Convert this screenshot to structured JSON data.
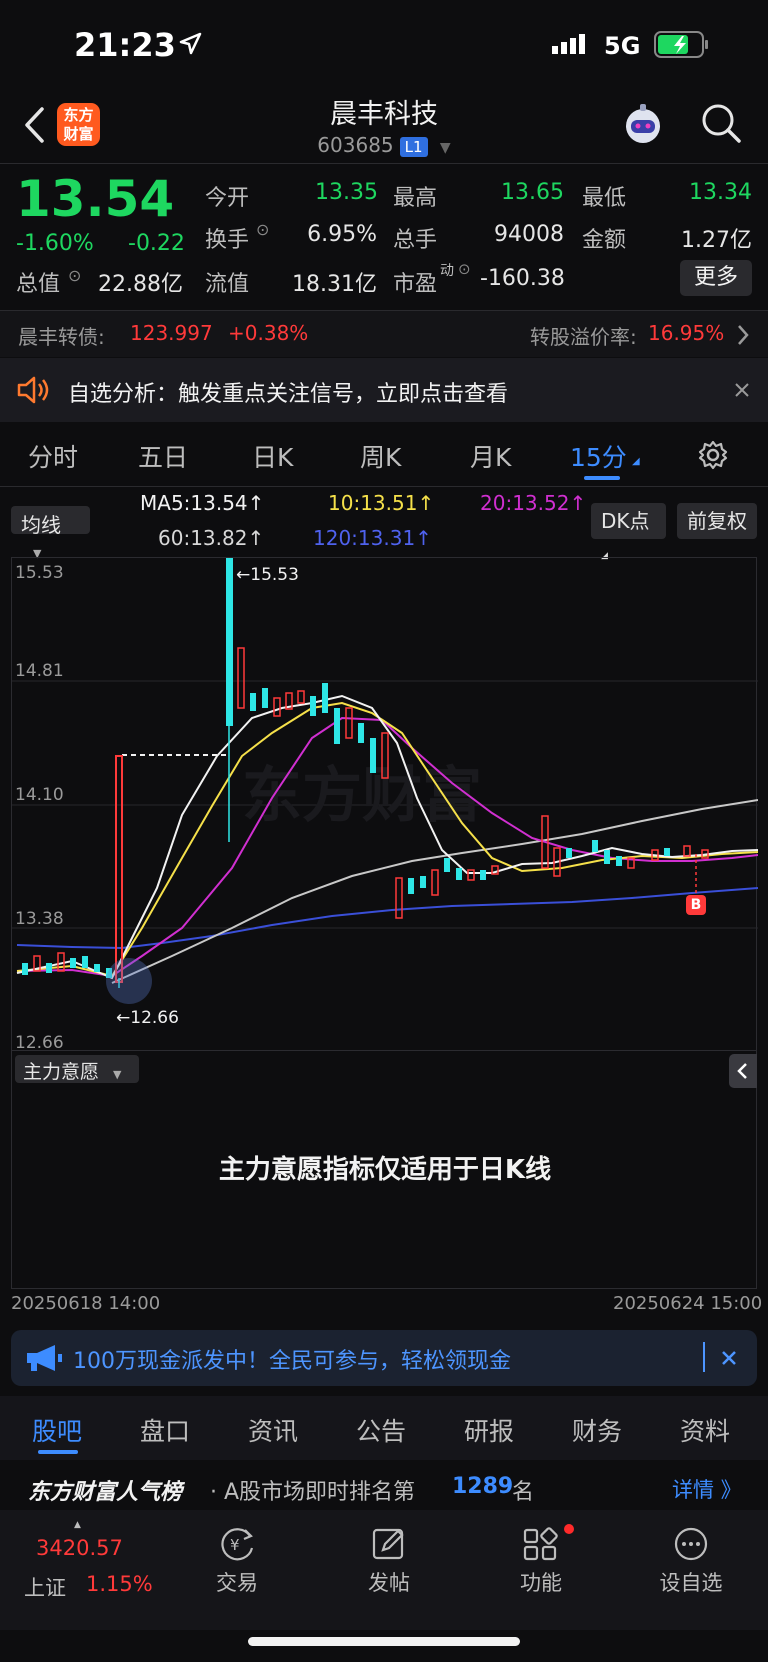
{
  "status": {
    "time": "21:23",
    "network": "5G"
  },
  "header": {
    "logo_text": "东方\n财富",
    "title": "晨丰科技",
    "code": "603685",
    "badge": "L1"
  },
  "quote": {
    "price": "13.54",
    "change_pct": "-1.60%",
    "change": "-0.22",
    "open_label": "今开",
    "open": "13.35",
    "high_label": "最高",
    "high": "13.65",
    "low_label": "最低",
    "low": "13.34",
    "turnover_label": "换手",
    "turnover": "6.95%",
    "volume_label": "总手",
    "volume": "94008",
    "amount_label": "金额",
    "amount": "1.27亿",
    "total_value_label": "总值",
    "total_value": "22.88亿",
    "float_value_label": "流值",
    "float_value": "18.31亿",
    "pe_label": "市盈",
    "pe_sup": "动",
    "pe": "-160.38",
    "more_button": "更多"
  },
  "bond": {
    "name": "晨丰转债:",
    "price": "123.997",
    "change": "+0.38%",
    "premium_label": "转股溢价率:",
    "premium": "16.95%"
  },
  "notice": {
    "text": "自选分析：触发重点关注信号，立即点击查看"
  },
  "chart_tabs": [
    "分时",
    "五日",
    "日K",
    "周K",
    "月K",
    "15分"
  ],
  "active_tab": "15分",
  "ma": {
    "selector": "均线",
    "ma5": "MA5:13.54↑",
    "ma10": "10:13.51↑",
    "ma20": "20:13.52↑",
    "ma60": "60:13.82↑",
    "ma120": "120:13.31↑",
    "dk_button": "DK点",
    "fq_button": "前复权"
  },
  "chart_data": {
    "type": "candlestick",
    "y_ticks": [
      "15.53",
      "14.81",
      "14.10",
      "13.38",
      "12.66"
    ],
    "ylim": [
      12.66,
      15.53
    ],
    "max_label": "15.53",
    "min_label": "12.66",
    "x_start": "20250618 14:00",
    "x_end": "20250624 15:00",
    "colors": {
      "up": "#ff3a3a",
      "down": "#2ee6e6",
      "ma5": "#ffffff",
      "ma10": "#f5e04a",
      "ma20": "#d02fd0",
      "ma60": "#c8c8c8",
      "ma120": "#3a4fd8"
    }
  },
  "indicator": {
    "selector": "主力意愿",
    "message": "主力意愿指标仅适用于日K线"
  },
  "banner": {
    "text": "100万现金派发中！全民可参与，轻松领现金"
  },
  "bottom_tabs": [
    "股吧",
    "盘口",
    "资讯",
    "公告",
    "研报",
    "财务",
    "资料"
  ],
  "ranking": {
    "brand": "东方财富人气榜",
    "prefix": "· A股市场即时排名第",
    "rank": "1289",
    "suffix": "名",
    "detail": "详情 》"
  },
  "toolbar": {
    "index_value": "3420.57",
    "index_name": "上证",
    "index_change": "1.15%",
    "trade": "交易",
    "post": "发帖",
    "functions": "功能",
    "watchlist": "设自选"
  }
}
